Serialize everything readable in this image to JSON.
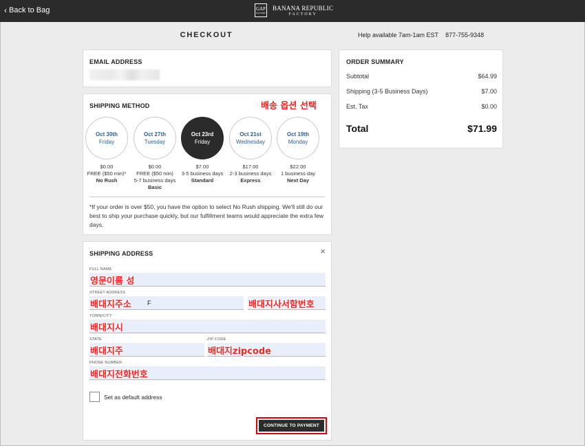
{
  "header": {
    "back_label": "Back to Bag",
    "logo_gap": "GAP",
    "logo_gap_sub": "FACTORY",
    "logo_br_line1": "BANANA REPUBLIC",
    "logo_br_line2": "FACTORY"
  },
  "page_title": "CHECKOUT",
  "help": {
    "text": "Help available 7am-1am EST",
    "phone": "877-755-9348"
  },
  "email_section": {
    "title": "EMAIL ADDRESS"
  },
  "shipping_method": {
    "title": "SHIPPING METHOD",
    "annotation": "배송 옵션 선택",
    "options": [
      {
        "date": "Oct 30th",
        "day": "Friday",
        "price": "$0.00",
        "desc": "FREE ($50 min)*",
        "name": "No Rush",
        "selected": false
      },
      {
        "date": "Oct 27th",
        "day": "Tuesday",
        "price": "$0.00",
        "desc": "FREE ($50 min) 5-7 business days",
        "name": "Basic",
        "selected": false
      },
      {
        "date": "Oct 23rd",
        "day": "Friday",
        "price": "$7.00",
        "desc": "3-5 business days",
        "name": "Standard",
        "selected": true
      },
      {
        "date": "Oct 21st",
        "day": "Wednesday",
        "price": "$17.00",
        "desc": "2-3 business days",
        "name": "Express",
        "selected": false
      },
      {
        "date": "Oct 19th",
        "day": "Monday",
        "price": "$22.00",
        "desc": "1 business day",
        "name": "Next Day",
        "selected": false
      }
    ],
    "note": "*If your order is over $50, you have the option to select No Rush shipping. We'll still do our best to ship your purchase quickly, but our fulfillment teams would appreciate the extra few days."
  },
  "shipping_address": {
    "title": "SHIPPING ADDRESS",
    "close_icon": "×",
    "full_name_label": "FULL NAME",
    "full_name_annot": "영문이름 성",
    "street_label": "STREET ADDRESS",
    "street_annot": "배대지주소",
    "street_extra": "F",
    "suite_annot": "배대지사서함번호",
    "town_label": "TOWN/CITY",
    "town_annot": "배대지시",
    "state_label": "STATE",
    "state_annot": "배대지주",
    "zip_label": "ZIP CODE",
    "zip_annot": "배대지zipcode",
    "phone_label": "PHONE NUMBER",
    "phone_annot": "배대지전화번호",
    "default_label": "Set as default address",
    "continue_label": "CONTINUE TO PAYMENT"
  },
  "order_summary": {
    "title": "ORDER SUMMARY",
    "rows": [
      {
        "label": "Subtotal",
        "value": "$64.99"
      },
      {
        "label": "Shipping (3-5 Business Days)",
        "value": "$7.00"
      },
      {
        "label": "Est. Tax",
        "value": "$0.00"
      }
    ],
    "total_label": "Total",
    "total_value": "$71.99"
  },
  "colors": {
    "topbar": "#2b2b2b",
    "link_blue": "#2a5f95",
    "annotation_red": "#ff1f1f",
    "field_bg": "#e9eefb"
  }
}
